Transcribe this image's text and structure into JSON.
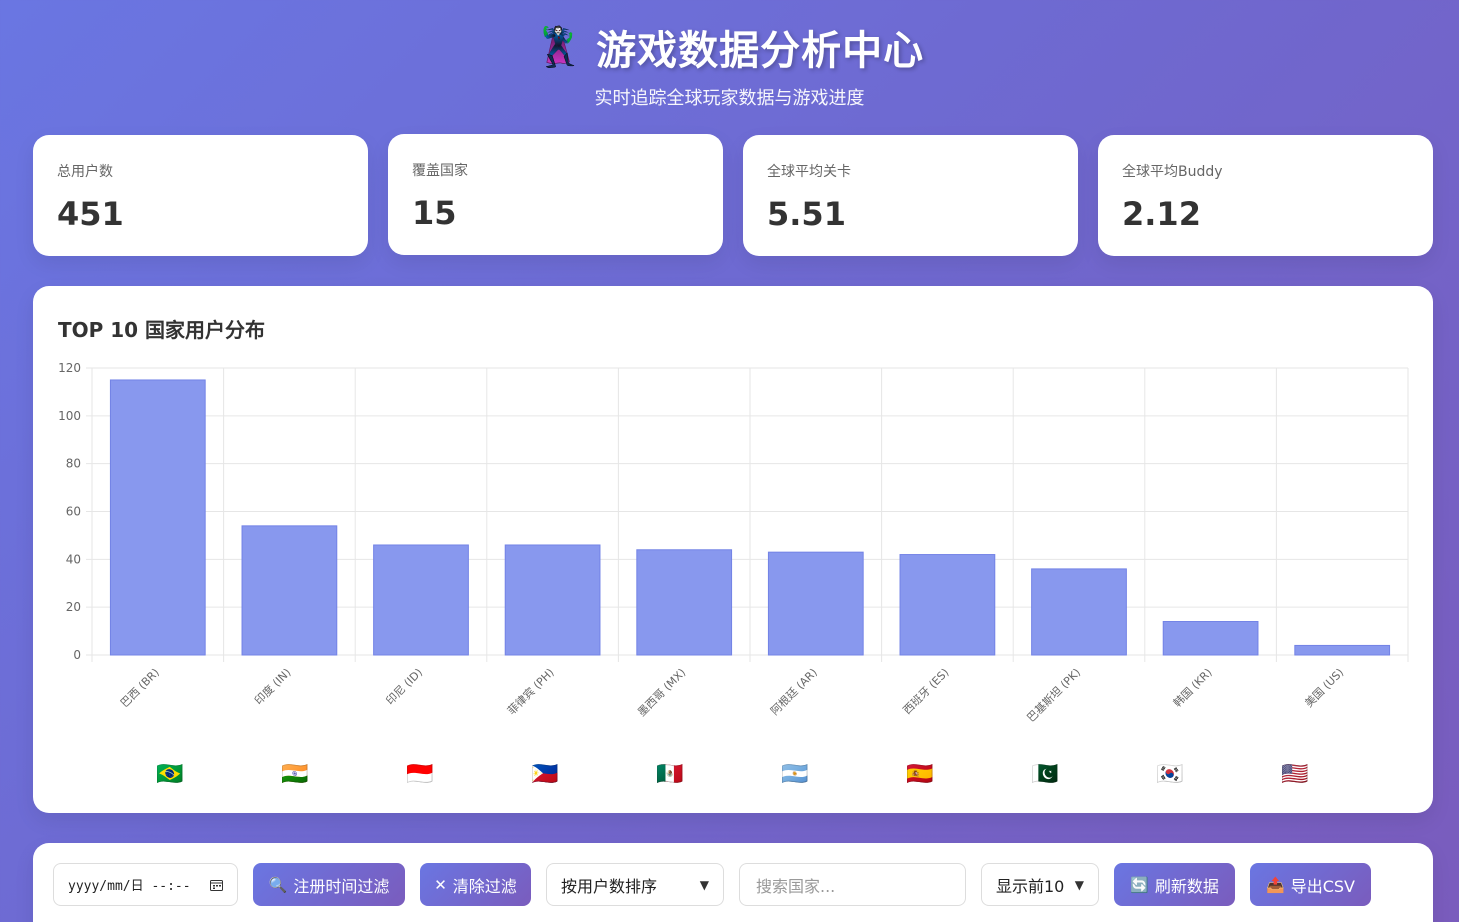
{
  "header": {
    "emoji": "🦹",
    "title": "游戏数据分析中心",
    "subtitle": "实时追踪全球玩家数据与游戏进度"
  },
  "stats": [
    {
      "label": "总用户数",
      "value": "451"
    },
    {
      "label": "覆盖国家",
      "value": "15"
    },
    {
      "label": "全球平均关卡",
      "value": "5.51"
    },
    {
      "label": "全球平均Buddy",
      "value": "2.12"
    }
  ],
  "chart": {
    "title": "TOP 10 国家用户分布"
  },
  "chart_data": {
    "type": "bar",
    "categories": [
      "巴西 (BR)",
      "印度 (IN)",
      "印尼 (ID)",
      "菲律宾 (PH)",
      "墨西哥 (MX)",
      "阿根廷 (AR)",
      "西班牙 (ES)",
      "巴基斯坦 (PK)",
      "韩国 (KR)",
      "美国 (US)"
    ],
    "flags": [
      "🇧🇷",
      "🇮🇳",
      "🇮🇩",
      "🇵🇭",
      "🇲🇽",
      "🇦🇷",
      "🇪🇸",
      "🇵🇰",
      "🇰🇷",
      "🇺🇸"
    ],
    "values": [
      115,
      54,
      46,
      46,
      44,
      43,
      42,
      36,
      14,
      4
    ],
    "yticks": [
      0,
      20,
      40,
      60,
      80,
      100,
      120
    ],
    "ylim": [
      0,
      120
    ],
    "bar_color": "#8898ee",
    "bar_border": "#7383e6",
    "grid": true
  },
  "controls": {
    "date_placeholder": "yyyy/mm/日 --:--",
    "filter_icon": "🔍",
    "filter_label": "注册时间过滤",
    "clear_icon": "✕",
    "clear_label": "清除过滤",
    "sort_value": "按用户数排序",
    "search_placeholder": "搜索国家...",
    "topn_value": "显示前10",
    "refresh_icon": "🔄",
    "refresh_label": "刷新数据",
    "export_icon": "📤",
    "export_label": "导出CSV"
  }
}
